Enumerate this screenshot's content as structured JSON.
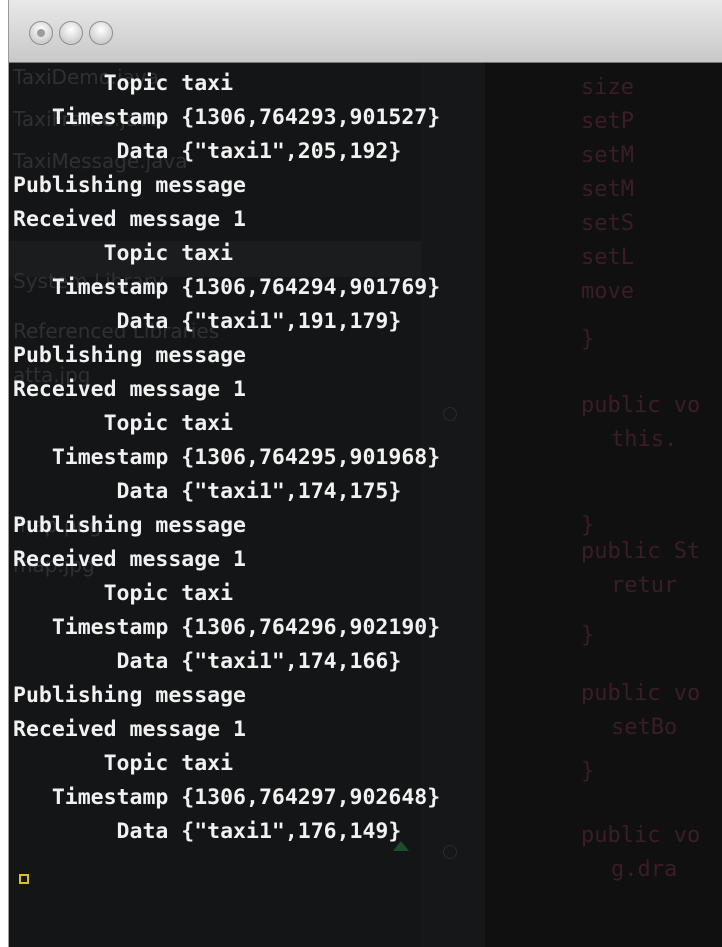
{
  "window": {
    "title": "",
    "traffic_lights": [
      "close",
      "minimize",
      "zoom"
    ]
  },
  "background": {
    "project_tree": [
      "TaxiDemo.java",
      "TaxiFrame.java",
      "TaxiMessage.java",
      "System Library",
      "Referenced Libraries",
      "atta.jpg",
      "map.png",
      "map.jpg"
    ],
    "code_lines": [
      "size",
      "setP",
      "setM",
      "setM",
      "setS",
      "setL",
      "move",
      "}",
      "public vo",
      "this.",
      "}",
      "public St",
      "retur",
      "}",
      "public vo",
      "setBo",
      "}",
      "public vo",
      "g.dra"
    ]
  },
  "console": {
    "lines": [
      "       Topic taxi",
      "   Timestamp {1306,764293,901527}",
      "        Data {\"taxi1\",205,192}",
      "Publishing message",
      "Received message 1",
      "       Topic taxi",
      "   Timestamp {1306,764294,901769}",
      "        Data {\"taxi1\",191,179}",
      "Publishing message",
      "Received message 1",
      "       Topic taxi",
      "   Timestamp {1306,764295,901968}",
      "        Data {\"taxi1\",174,175}",
      "Publishing message",
      "Received message 1",
      "       Topic taxi",
      "   Timestamp {1306,764296,902190}",
      "        Data {\"taxi1\",174,166}",
      "Publishing message",
      "Received message 1",
      "       Topic taxi",
      "   Timestamp {1306,764297,902648}",
      "        Data {\"taxi1\",176,149}"
    ],
    "text_color": "#f1f1f1",
    "background_color": "#121314",
    "cursor_color": "#d8c12a"
  }
}
